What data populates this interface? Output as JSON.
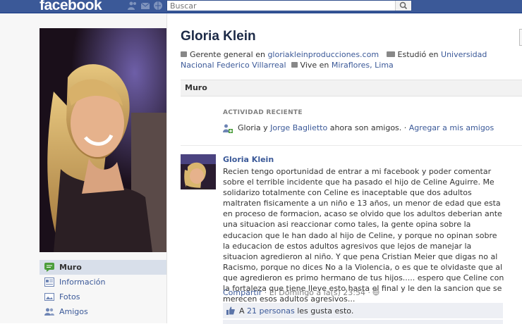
{
  "topbar": {
    "logo": "facebook",
    "search_placeholder": "Buscar",
    "icons": [
      "friend-requests-icon",
      "messages-icon",
      "notifications-icon",
      "search-icon"
    ]
  },
  "profile": {
    "name": "Gloria Klein",
    "work_prefix": "Gerente general en ",
    "work_link": "gloriakleinproducciones.com",
    "study_prefix": "Estudió en ",
    "study_link_1": "Universidad Nacional",
    "study_link_2": "Federico Villarreal",
    "lives_prefix": "Vive en ",
    "lives_link": "Miraflores, Lima"
  },
  "nav": {
    "items": [
      {
        "label": "Muro",
        "icon": "wall-icon",
        "active": true
      },
      {
        "label": "Información",
        "icon": "info-icon",
        "active": false
      },
      {
        "label": "Fotos",
        "icon": "photos-icon",
        "active": false
      },
      {
        "label": "Amigos",
        "icon": "friends-icon",
        "active": false
      }
    ]
  },
  "wall": {
    "tab_label": "Muro",
    "recent_heading": "ACTIVIDAD RECIENTE",
    "recent_prefix": "Gloria y ",
    "recent_friend": "Jorge Baglietto",
    "recent_suffix": " ahora son amigos. · ",
    "recent_action": "Agregar a mis amigos"
  },
  "post": {
    "author": "Gloria Klein",
    "text": "Recien tengo oportunidad de entrar a mi facebook y poder comentar sobre el terrible incidente que ha pasado el hijo de Celine Aguirre. Me solidarizo totalmente con Celine es inaceptable que dos adultos maltraten fisicamente a un niño e 13 años, un menor de edad que esta en proceso de formacion, acaso se olvido que los adultos deberian ante una situacion asi reaccionar como tales, la gente opina sobre la educacion que le han dado al hijo de Celine, y porque no opinan sobre la educacion de estos adultos agresivos que lejos de manejar la situacion agredieron al niño. Y que pena Cristian Meier que digas no al Racismo, porque no dices No a la Violencia, o es que te olvidaste que al que agredieron es primo hermano de tus hijos..... espero que Celine con la fortaleza que tiene lleve esto hasta el final y le den la sancion que se merecen esos adultos agresivos...",
    "share": "Compartir",
    "timestamp": " · El Domingo a la(s) 23:54 · ",
    "likes_prefix": "A ",
    "likes_link": "21 personas",
    "likes_suffix": " les gusta esto."
  },
  "colors": {
    "brand": "#3b5998",
    "nav_active": "#d8dfea",
    "likes_bg": "#edeff4"
  }
}
